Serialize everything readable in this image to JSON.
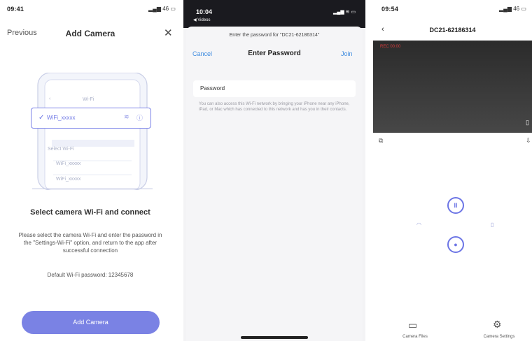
{
  "panel1": {
    "status_time": "09:41",
    "status_right": "46",
    "nav_prev": "Previous",
    "title": "Add Camera",
    "close_glyph": "✕",
    "illustration": {
      "header": "Wi-Fi",
      "selected_ssid": "WiFi_xxxxx",
      "section_label": "Select Wi-Fi",
      "other_ssid_1": "WiFi_xxxxx",
      "other_ssid_2": "WiFi_xxxxx"
    },
    "heading": "Select camera Wi-Fi and connect",
    "description": "Please select the camera Wi-Fi and enter the password in the \"Settings-Wi-Fi\" option, and return to the app after successful connection",
    "default_password": "Default Wi-Fi password: 12345678",
    "add_button": "Add Camera",
    "accent": "#7a82e4"
  },
  "panel2": {
    "status_time": "10:04",
    "back_app": "◀ Videos",
    "prompt": "Enter the password for \"DC21-62186314\"",
    "cancel": "Cancel",
    "title": "Enter Password",
    "join": "Join",
    "field_label": "Password",
    "help": "You can also access this Wi-Fi network by bringing your iPhone near any iPhone, iPad, or Mac which has connected to this network and has you in their contacts.",
    "link_color": "#3f8ce0"
  },
  "panel3": {
    "status_time": "09:54",
    "status_right": "46",
    "title": "DC21-62186314",
    "video_overlay": "REC 00:00",
    "tab_files": "Camera Files",
    "tab_settings": "Camera Settings"
  }
}
